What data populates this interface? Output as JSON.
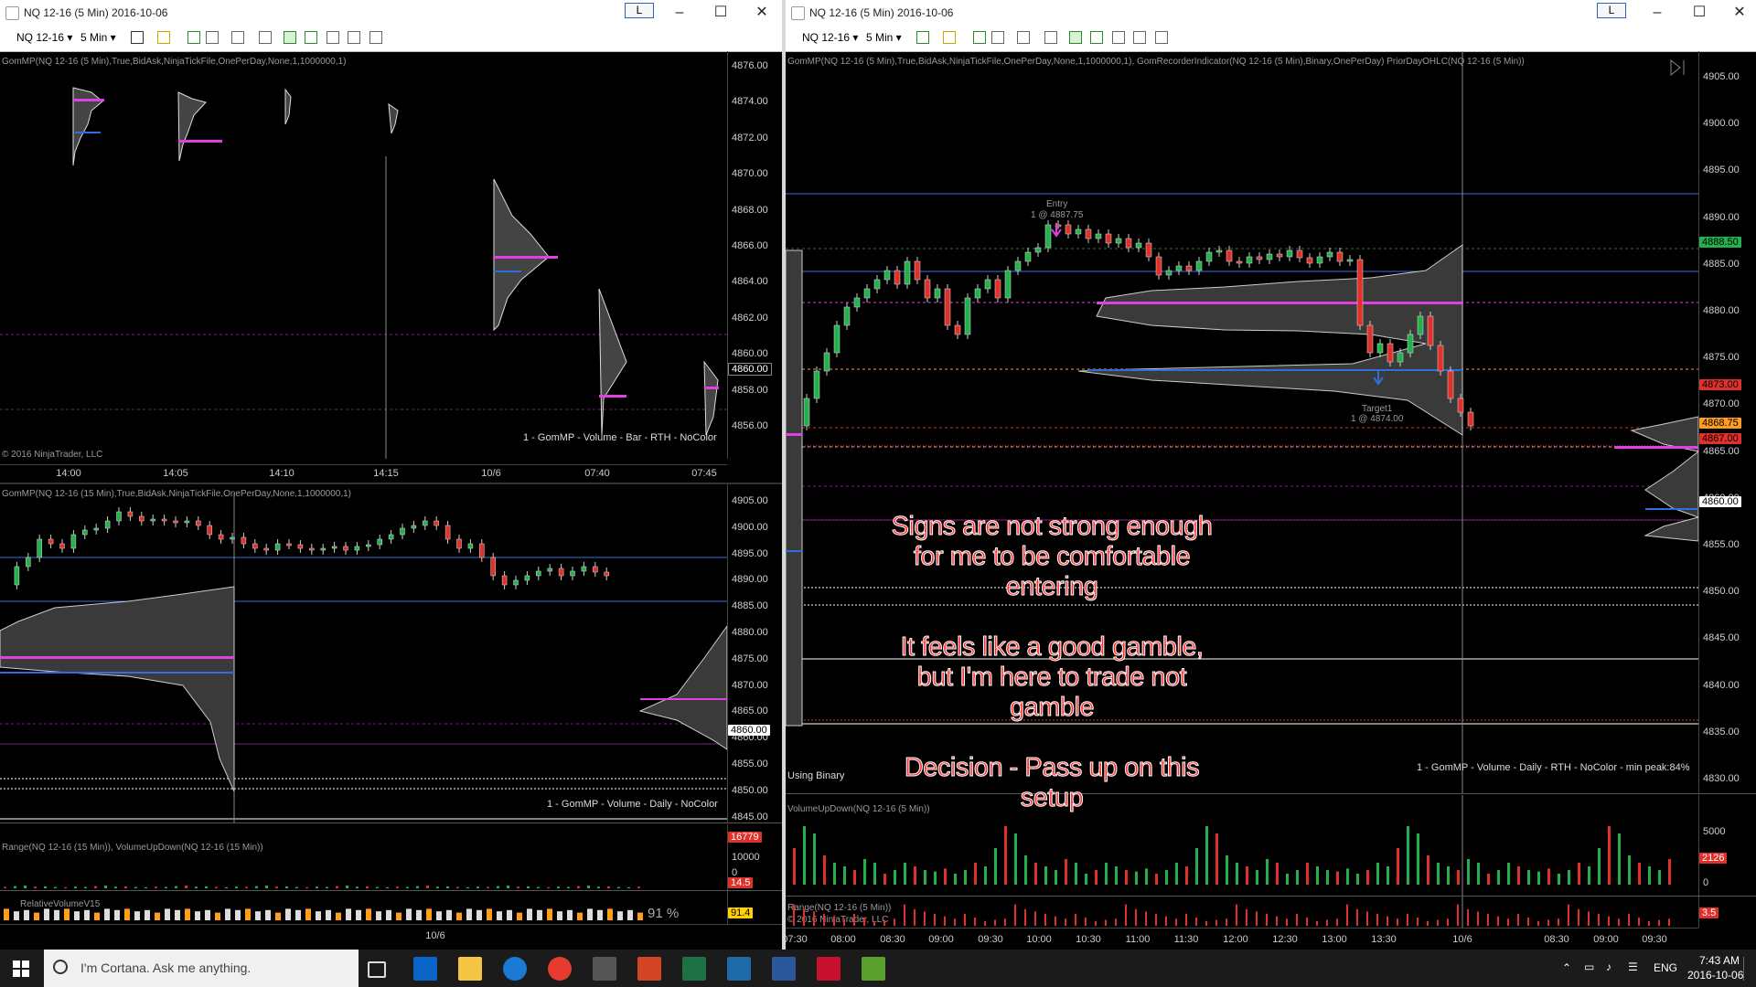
{
  "left_window": {
    "title": "NQ 12-16 (5 Min)  2016-10-06",
    "instrument": "NQ 12-16",
    "period": "5 Min",
    "layout_btn": "L",
    "top_chart": {
      "indicator_label": "GomMP(NQ 12-16 (5 Min),True,BidAsk,NinjaTickFile,OnePerDay,None,1,1000000,1)",
      "prices": [
        "4876.00",
        "4874.00",
        "4872.00",
        "4870.00",
        "4868.00",
        "4866.00",
        "4864.00",
        "4862.00",
        "4860.00",
        "4858.00",
        "4856.00"
      ],
      "current_price": "4860.00",
      "times": [
        "14:00",
        "14:05",
        "14:10",
        "14:15",
        "10/6",
        "07:40",
        "07:45"
      ],
      "footer": "1 - GomMP  - Volume - Bar - RTH - NoColor",
      "copyright": "© 2016 NinjaTrader, LLC"
    },
    "bottom_chart": {
      "indicator_label": "GomMP(NQ 12-16 (15 Min),True,BidAsk,NinjaTickFile,OnePerDay,None,1,1000000,1)",
      "prices": [
        "4905.00",
        "4900.00",
        "4895.00",
        "4890.00",
        "4885.00",
        "4880.00",
        "4875.00",
        "4870.00",
        "4865.00",
        "4860.00",
        "4855.00",
        "4850.00",
        "4845.00"
      ],
      "current_price": "4860.00",
      "footer": "1 - GomMP  - Volume - Daily - NoColor",
      "vol_label": "Range(NQ 12-16 (15 Min)), VolumeUpDown(NQ 12-16 (15 Min))",
      "vol_value": "16779",
      "vol_scale": "10000",
      "vol_zero": "0",
      "range_value": "14.5",
      "rv_label": "RelativeVolumeV15",
      "rv_value": "91.4",
      "rv_percent": "91 %",
      "time_label": "10/6"
    }
  },
  "right_window": {
    "title": "NQ 12-16 (5 Min)  2016-10-06",
    "instrument": "NQ 12-16",
    "period": "5 Min",
    "layout_btn": "L",
    "indicator_label": "GomMP(NQ 12-16 (5 Min),True,BidAsk,NinjaTickFile,OnePerDay,None,1,1000000,1), GomRecorderIndicator(NQ 12-16 (5 Min),Binary,OnePerDay) PriorDayOHLC(NQ 12-16 (5 Min))",
    "prices": [
      "4905.00",
      "4900.00",
      "4895.00",
      "4890.00",
      "4885.00",
      "4880.00",
      "4875.00",
      "4870.00",
      "4865.00",
      "4860.00",
      "4855.00",
      "4850.00",
      "4845.00",
      "4840.00",
      "4835.00",
      "4830.00"
    ],
    "tags": [
      {
        "text": "4888.50",
        "color": "#22b14c"
      },
      {
        "text": "4873.00",
        "color": "#e0302a"
      },
      {
        "text": "4868.75",
        "color": "#ff9d1e"
      },
      {
        "text": "4867.00",
        "color": "#e0302a"
      },
      {
        "text": "4860.00",
        "color": "#ffffff"
      }
    ],
    "entry_label": "Entry",
    "entry_price": "1 @ 4887.75",
    "target_label": "Target1",
    "target_price": "1 @ 4874.00",
    "footer": "1 - GomMP  - Volume - Daily - RTH - NoColor - min peak:84%",
    "binary_label": "Using Binary",
    "vol_label": "VolumeUpDown(NQ 12-16 (5 Min))",
    "vol_ticks": [
      "5000",
      "0"
    ],
    "vol_value": "2126",
    "range_label": "Range(NQ 12-16 (5 Min))",
    "range_value": "3.5",
    "copyright": "© 2016 NinjaTrader, LLC",
    "times": [
      "07:30",
      "08:00",
      "08:30",
      "09:00",
      "09:30",
      "10:00",
      "10:30",
      "11:00",
      "11:30",
      "12:00",
      "12:30",
      "13:00",
      "13:30",
      "10/6",
      "08:30",
      "09:00",
      "09:30"
    ]
  },
  "annotations": {
    "line1": "Signs are not strong enough",
    "line2": "for me to be comfortable",
    "line3": "entering",
    "line4": "It feels like a good gamble,",
    "line5": "but I'm here to trade not",
    "line6": "gamble",
    "line7": "Decision - Pass up on this",
    "line8": "setup"
  },
  "taskbar": {
    "cortana_placeholder": "I'm Cortana. Ask me anything.",
    "lang": "ENG",
    "time": "7:43 AM",
    "date": "2016-10-06"
  },
  "colors": {
    "up": "#22b14c",
    "down": "#e0302a",
    "magenta": "#e040e0",
    "blue": "#2e6fe0"
  }
}
